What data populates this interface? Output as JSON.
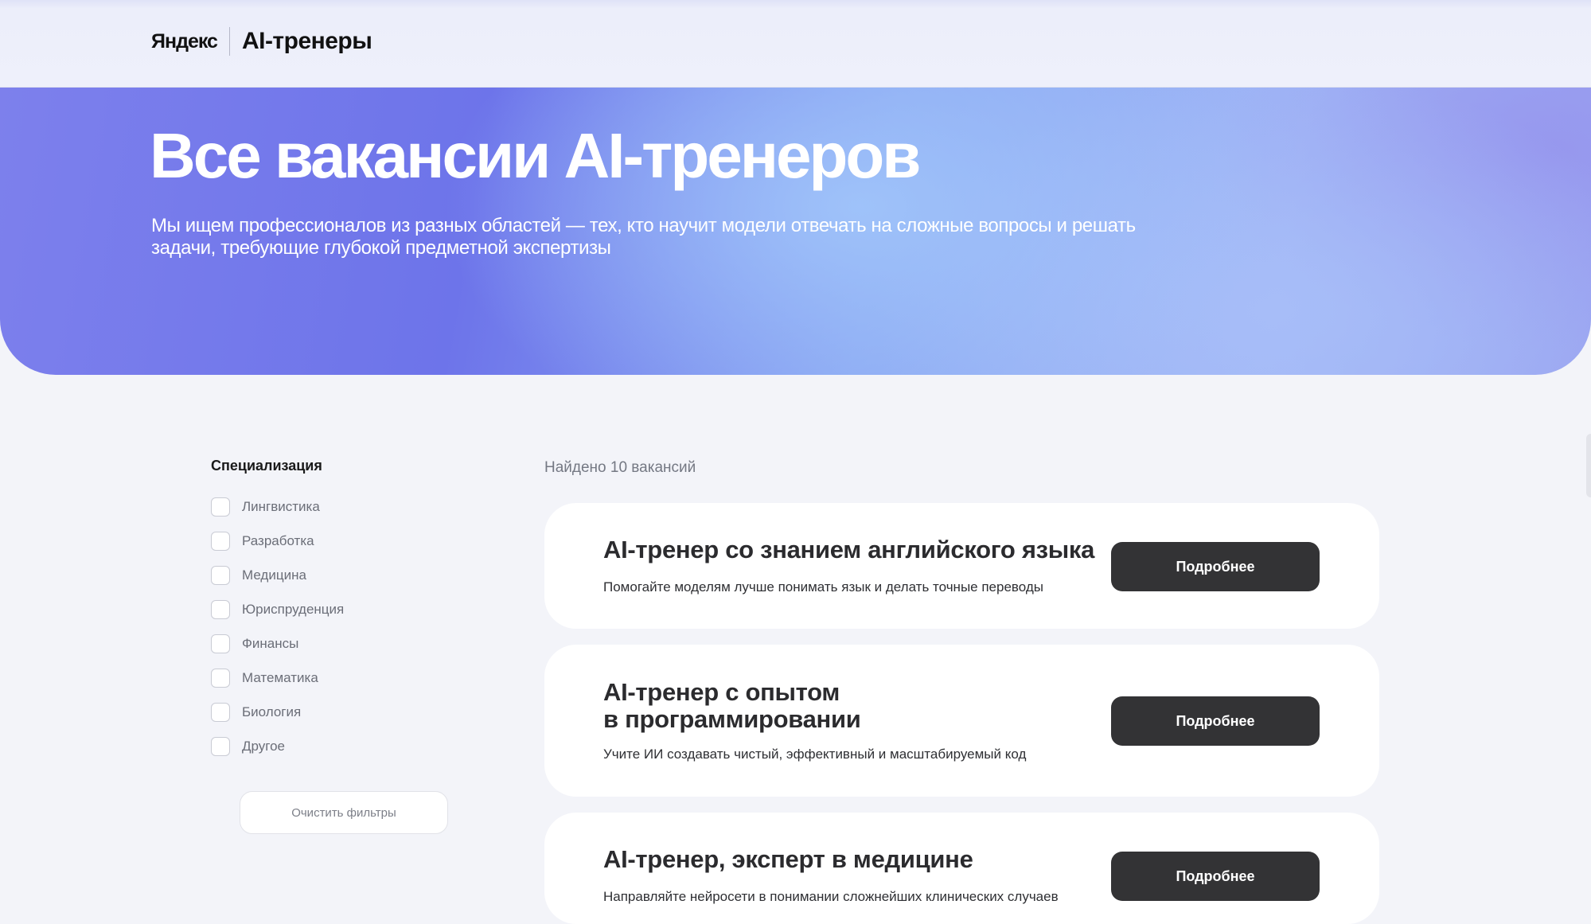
{
  "header": {
    "logo_brand": "Яндекс",
    "logo_product": "AI-тренеры"
  },
  "hero": {
    "title": "Все вакансии AI-тренеров",
    "subtitle": "Мы ищем профессионалов из разных областей — тех, кто научит модели отвечать на сложные вопросы и решать задачи, требующие глубокой предметной экспертизы"
  },
  "filters": {
    "title": "Специализация",
    "items": [
      {
        "label": "Лингвистика",
        "checked": false
      },
      {
        "label": "Разработка",
        "checked": false
      },
      {
        "label": "Медицина",
        "checked": false
      },
      {
        "label": "Юриспруденция",
        "checked": false
      },
      {
        "label": "Финансы",
        "checked": false
      },
      {
        "label": "Математика",
        "checked": false
      },
      {
        "label": "Биология",
        "checked": false
      },
      {
        "label": "Другое",
        "checked": false
      }
    ],
    "clear_label": "Очистить фильтры"
  },
  "results": {
    "count_text": "Найдено 10 вакансий",
    "vacancies": [
      {
        "title": "AI-тренер со знанием английского языка",
        "description": "Помогайте моделям лучше понимать язык и делать точные переводы",
        "button_label": "Подробнее"
      },
      {
        "title_line1": "AI-тренер с опытом",
        "title_line2": "в программировании",
        "description": "Учите ИИ создавать чистый, эффективный и масштабируемый код",
        "button_label": "Подробнее"
      },
      {
        "title": "AI-тренер, эксперт в медицине",
        "description": "Направляйте нейросети в понимании сложнейших клинических случаев",
        "button_label": "Подробнее"
      }
    ]
  }
}
